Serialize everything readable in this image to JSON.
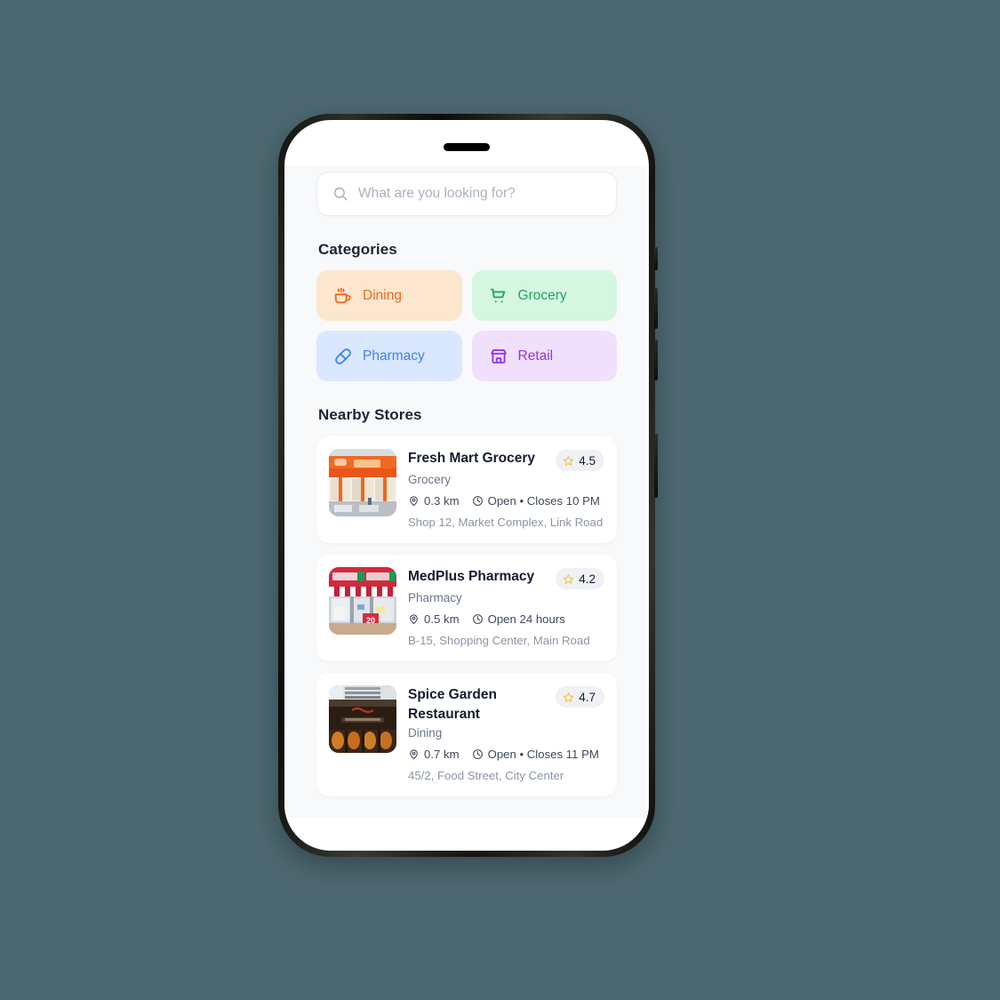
{
  "theme": {
    "page_background": "#4c6871",
    "screen_background": "#f7f9fb",
    "card_background": "#ffffff",
    "text_primary": "#141c2e",
    "text_muted": "#6b7688",
    "star_color": "#f5c33b"
  },
  "device": {
    "speaker_name": "earpiece-speaker",
    "buttons": [
      "silent-switch",
      "volume-up",
      "volume-down",
      "power"
    ]
  },
  "search": {
    "icon": "search-icon",
    "value": "",
    "placeholder": "What are you looking for?"
  },
  "categories": {
    "title": "Categories",
    "items": [
      {
        "label": "Dining",
        "icon": "coffee-cup-icon",
        "bg": "#fde6ce",
        "color": "#ef6820"
      },
      {
        "label": "Grocery",
        "icon": "shopping-cart-icon",
        "bg": "#d5f6e0",
        "color": "#1fa75d"
      },
      {
        "label": "Pharmacy",
        "icon": "pill-capsule-icon",
        "bg": "#dae8fd",
        "color": "#3b82f6"
      },
      {
        "label": "Retail",
        "icon": "store-front-icon",
        "bg": "#f1e0fb",
        "color": "#9333ea"
      }
    ]
  },
  "nearby": {
    "title": "Nearby Stores",
    "stores": [
      {
        "name": "Fresh Mart Grocery",
        "category": "Grocery",
        "rating": "4.5",
        "distance": "0.3 km",
        "hours": "Open • Closes 10 PM",
        "address": "Shop 12, Market Complex, Link Road",
        "thumbnail": "grocery-storefront-photo"
      },
      {
        "name": "MedPlus Pharmacy",
        "category": "Pharmacy",
        "rating": "4.2",
        "distance": "0.5 km",
        "hours": "Open 24 hours",
        "address": "B-15, Shopping Center, Main Road",
        "thumbnail": "pharmacy-storefront-photo"
      },
      {
        "name": "Spice Garden Restaurant",
        "category": "Dining",
        "rating": "4.7",
        "distance": "0.7 km",
        "hours": "Open • Closes 11 PM",
        "address": "45/2, Food Street, City Center",
        "thumbnail": "restaurant-storefront-photo"
      }
    ],
    "meta_icons": {
      "distance": "map-pin-icon",
      "hours": "clock-icon"
    },
    "rating_icon": "star-icon"
  }
}
